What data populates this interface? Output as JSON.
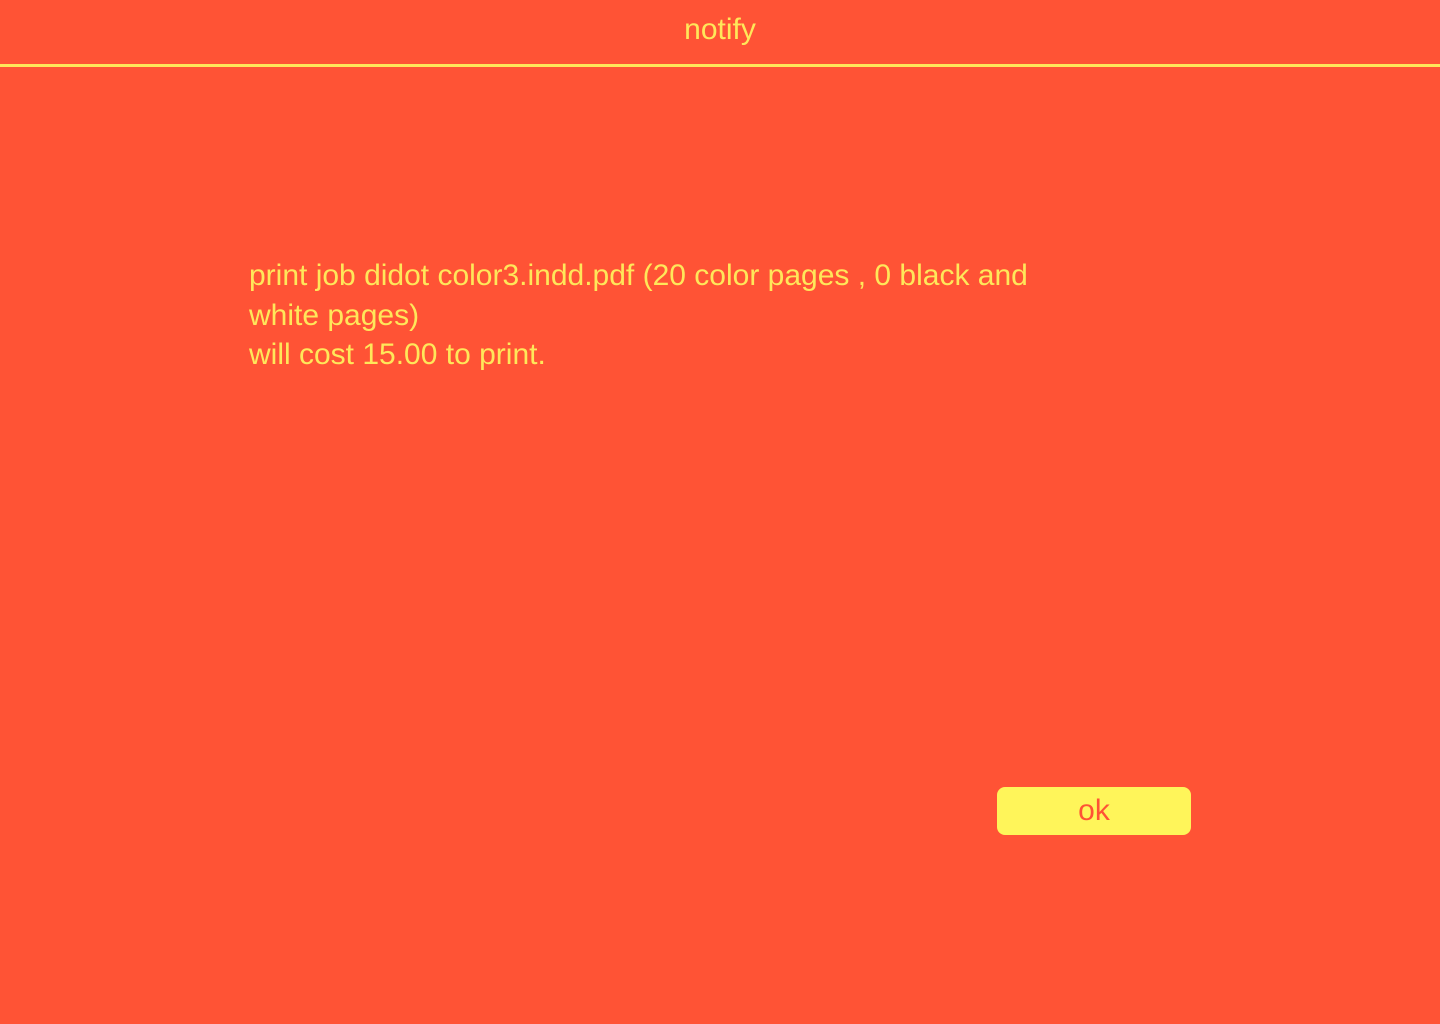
{
  "window": {
    "title": "notify"
  },
  "message": {
    "line1": "print job didot color3.indd.pdf (20 color pages , 0 black and",
    "line2": "white pages)",
    "line3": "will cost 15.00 to print."
  },
  "actions": {
    "ok_label": "ok"
  },
  "colors": {
    "background": "#ff5335",
    "text": "#ffe75a",
    "button_background": "#fff55a",
    "button_text": "#ff5335"
  }
}
